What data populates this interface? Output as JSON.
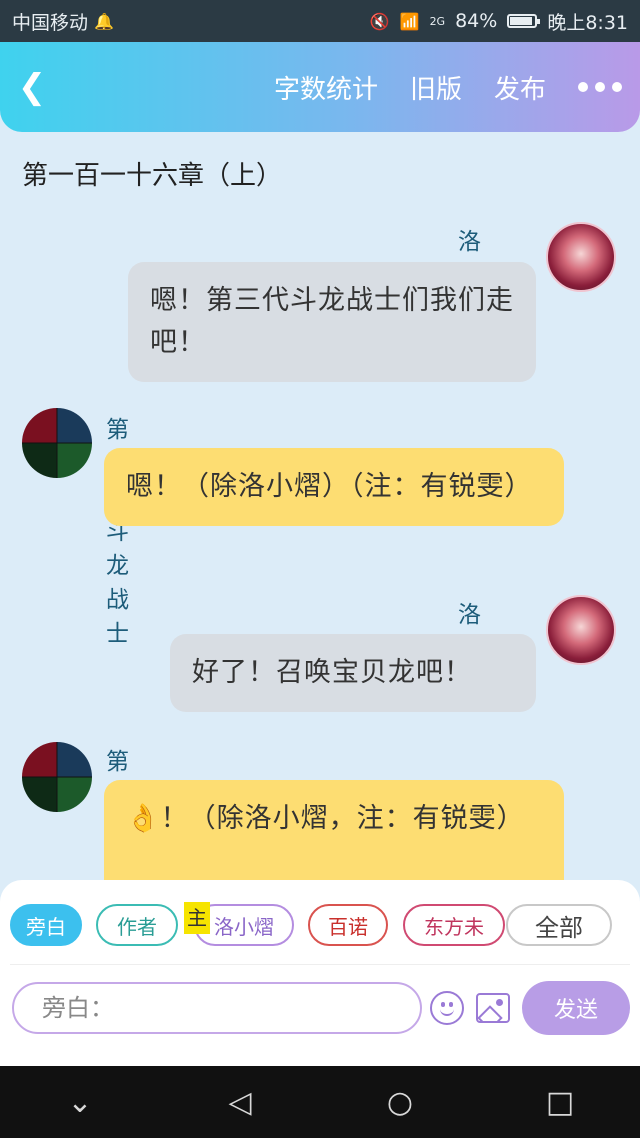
{
  "status_bar": {
    "carrier": "中国移动",
    "network": "2G",
    "battery": "84%",
    "battery_level": 0.84,
    "time": "晚上8:31"
  },
  "header": {
    "word_count": "字数统计",
    "old_version": "旧版",
    "publish": "发布"
  },
  "chapter_title": "第一百一十六章（上）",
  "messages": [
    {
      "side": "right",
      "sender": "洛小熠",
      "text": "嗯！第三代斗龙战士们我们走吧！"
    },
    {
      "side": "left",
      "sender": "第三代斗龙战士",
      "text": "嗯！（除洛小熠）（注：有锐雯）"
    },
    {
      "side": "right",
      "sender": "洛小熠",
      "text": "好了！召唤宝贝龙吧！"
    },
    {
      "side": "left",
      "sender": "第三代斗龙战士",
      "text": "👌！（除洛小熠，注：有锐雯）"
    }
  ],
  "roles": {
    "narration": "旁白",
    "author": "作者",
    "main_tag": "主",
    "luo": "洛小熠",
    "bai": "百诺",
    "dong": "东方未",
    "all": "全部"
  },
  "composer": {
    "placeholder": "旁白：",
    "send": "发送"
  }
}
